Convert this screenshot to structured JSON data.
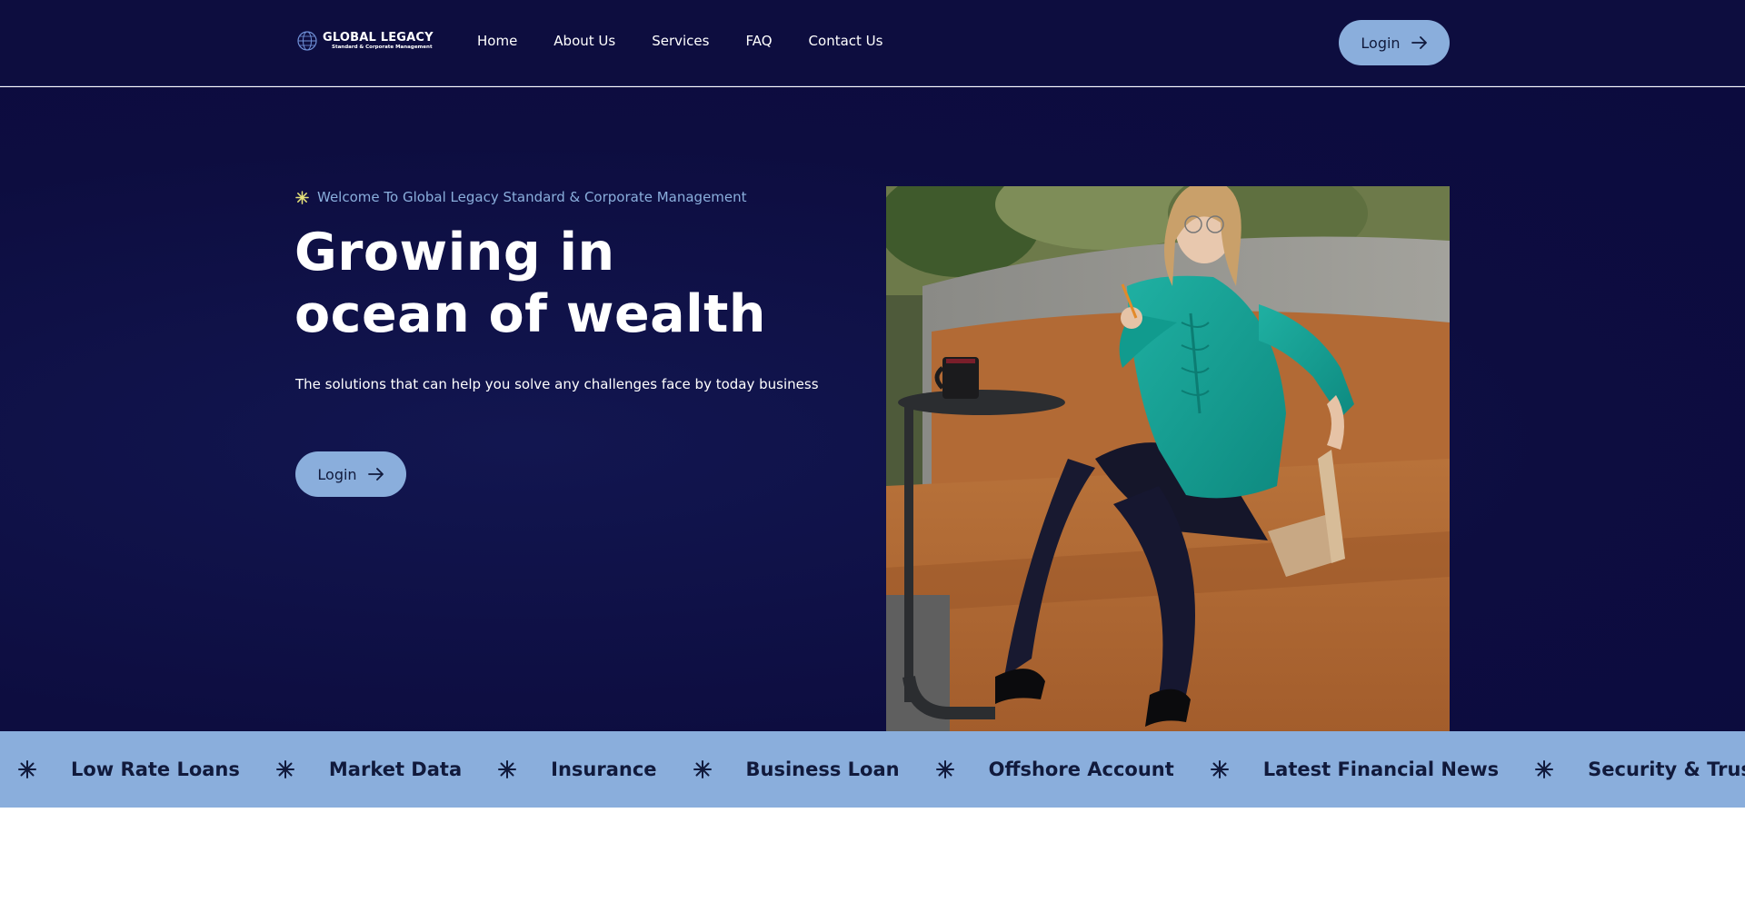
{
  "brand": {
    "title": "GLOBAL LEGACY",
    "subtitle": "Standard & Corporate Management"
  },
  "nav": {
    "links": [
      "Home",
      "About Us",
      "Services",
      "FAQ",
      "Contact Us"
    ],
    "login_label": "Login"
  },
  "hero": {
    "welcome": "Welcome To Global Legacy Standard & Corporate Management",
    "title": "Growing in ocean of wealth",
    "description": "The solutions that can help you solve any challenges face by today business",
    "login_label": "Login"
  },
  "ticker": {
    "items": [
      "Low Rate Loans",
      "Market Data",
      "Insurance",
      "Business Loan",
      "Offshore Account",
      "Latest Financial News",
      "Security & Trust"
    ]
  },
  "colors": {
    "navy": "#0d0d3f",
    "accent": "#8aaedc",
    "star_yellow": "#e6e27a"
  }
}
